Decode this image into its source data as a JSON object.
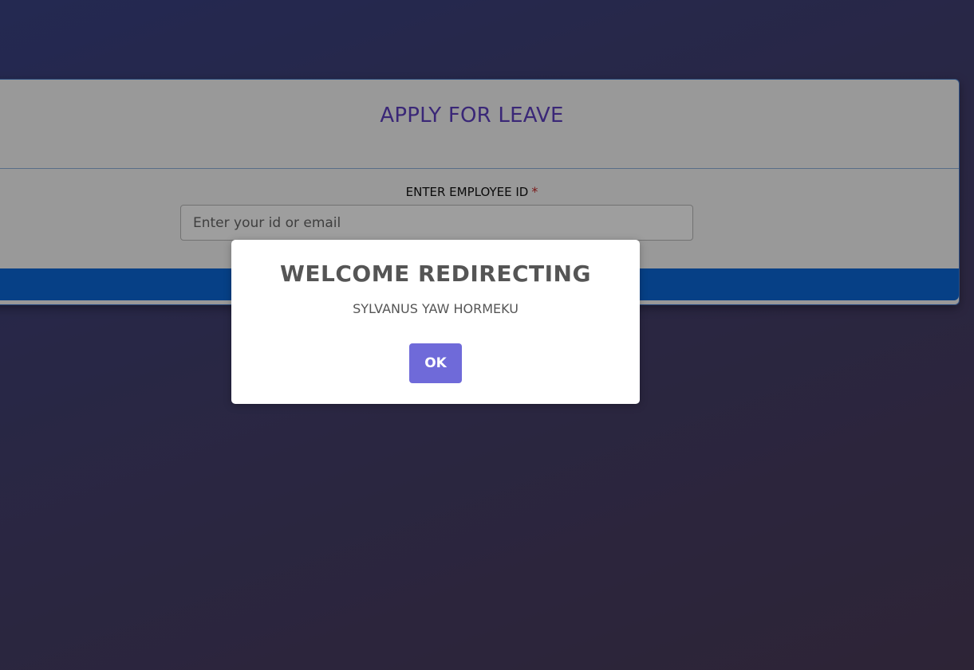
{
  "form": {
    "title": "APPLY FOR LEAVE",
    "employee_label": "ENTER EMPLOYEE ID",
    "required_mark": "*",
    "employee_placeholder": "Enter your id or email",
    "employee_value": ""
  },
  "modal": {
    "title": "WELCOME REDIRECTING",
    "message": "SYLVANUS YAW HORMEKU",
    "ok_label": "OK"
  },
  "colors": {
    "title": "#5e3fc1",
    "submit_bar": "#0b68d9",
    "ok_button": "#6f6ad9",
    "required": "#c62828"
  }
}
